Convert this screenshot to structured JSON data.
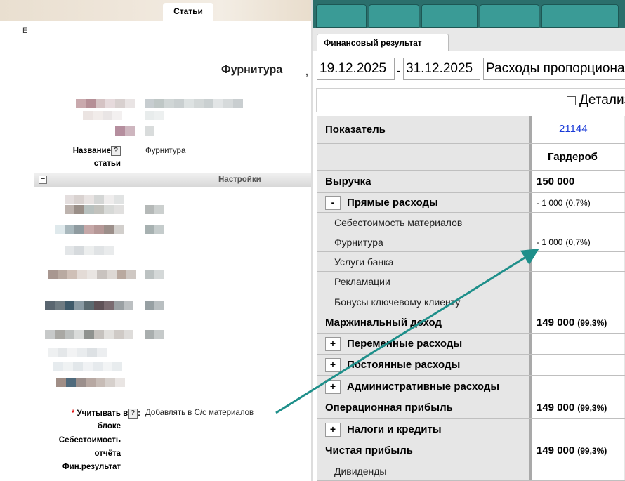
{
  "left_panel": {
    "tab_label": "Статьи",
    "stray_char": "E",
    "heading": "Фурнитура",
    "heading_tail": ",",
    "name_label": "Название",
    "name_label_2": "статьи",
    "help_glyph": "?",
    "name_value": "Фурнитура",
    "collapse_glyph": "−",
    "settings_label": "Настройки",
    "required_mark": "*",
    "account_label_1": "Учитывать в",
    "account_label_2": "блоке",
    "account_label_3": "Себестоимость",
    "account_label_4": "отчёта",
    "account_label_5": "Фин.результат",
    "colon": ":",
    "account_value": "Добавлять в С/с материалов"
  },
  "right_panel": {
    "tab_label": "Финансовый результат",
    "date_from": "19.12.2025",
    "date_sep": "-",
    "date_to": "31.12.2025",
    "mode_select": "Расходы пропорционально",
    "detail_label": "Детализация",
    "table": {
      "header_label": "Показатель",
      "column_id": "21144",
      "column_name": "Гардероб",
      "rows": [
        {
          "label": "Выручка",
          "value": "150 000",
          "pct": ""
        },
        {
          "toggle": "-",
          "label": "Прямые расходы",
          "value": "- 1 000",
          "pct": "(0,7%)"
        },
        {
          "label": "Себестоимость материалов",
          "value": "",
          "pct": ""
        },
        {
          "label": "Фурнитура",
          "value": "- 1 000",
          "pct": "(0,7%)"
        },
        {
          "label": "Услуги банка",
          "value": "",
          "pct": ""
        },
        {
          "label": "Рекламации",
          "value": "",
          "pct": ""
        },
        {
          "label": "Бонусы ключевому клиенту",
          "value": "",
          "pct": ""
        },
        {
          "label": "Маржинальный доход",
          "value": "149 000",
          "pct": "(99,3%)"
        },
        {
          "toggle": "+",
          "label": "Переменные расходы",
          "value": "",
          "pct": ""
        },
        {
          "toggle": "+",
          "label": "Постоянные расходы",
          "value": "",
          "pct": ""
        },
        {
          "toggle": "+",
          "label": "Административные расходы",
          "value": "",
          "pct": ""
        },
        {
          "label": "Операционная прибыль",
          "value": "149 000",
          "pct": "(99,3%)"
        },
        {
          "toggle": "+",
          "label": "Налоги и кредиты",
          "value": "",
          "pct": ""
        },
        {
          "label": "Чистая прибыль",
          "value": "149 000",
          "pct": "(99,3%)"
        },
        {
          "label": "Дивиденды",
          "value": "",
          "pct": ""
        }
      ]
    }
  },
  "colors": {
    "annotation_arrow": "#1e8f8a",
    "tab_teal": "#3a9b96",
    "link_blue": "#1a3bd8",
    "label_cell_gray": "#e6e6e6"
  }
}
